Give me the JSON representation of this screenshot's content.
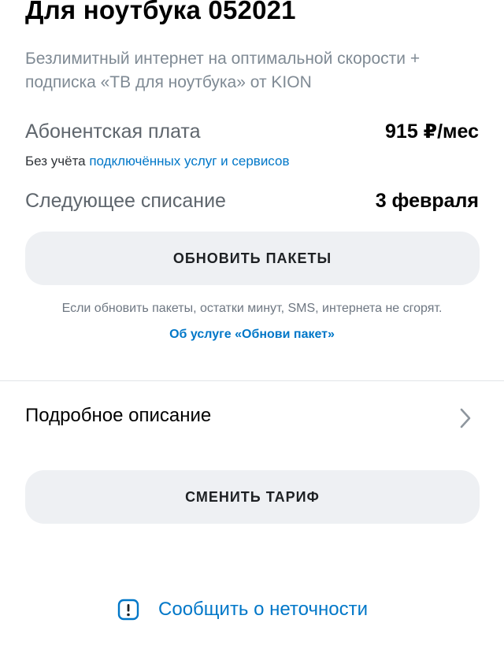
{
  "tariff": {
    "title": "Для ноутбука 052021",
    "description": "Безлимитный интернет на оптимальной скорости + подписка «ТВ для ноутбука» от KION"
  },
  "fee": {
    "label": "Абонентская плата",
    "value": "915 ₽/мес",
    "note_prefix": "Без учёта ",
    "note_link": "подключённых услуг и сервисов"
  },
  "next_charge": {
    "label": "Следующее списание",
    "value": "3 февраля"
  },
  "update_packages": {
    "button_label": "ОБНОВИТЬ ПАКЕТЫ",
    "note": "Если обновить пакеты, остатки минут, SMS, интернета не сгорят.",
    "link": "Об услуге «Обнови пакет»"
  },
  "details": {
    "label": "Подробное описание",
    "icon": "chevron-right-icon"
  },
  "change_tariff": {
    "button_label": "СМЕНИТЬ ТАРИФ"
  },
  "report": {
    "label": "Сообщить о неточности",
    "icon": "exclamation-icon"
  },
  "colors": {
    "accent": "#0077c8",
    "button_bg": "#eef0f3",
    "secondary_text": "#7f8a94"
  }
}
